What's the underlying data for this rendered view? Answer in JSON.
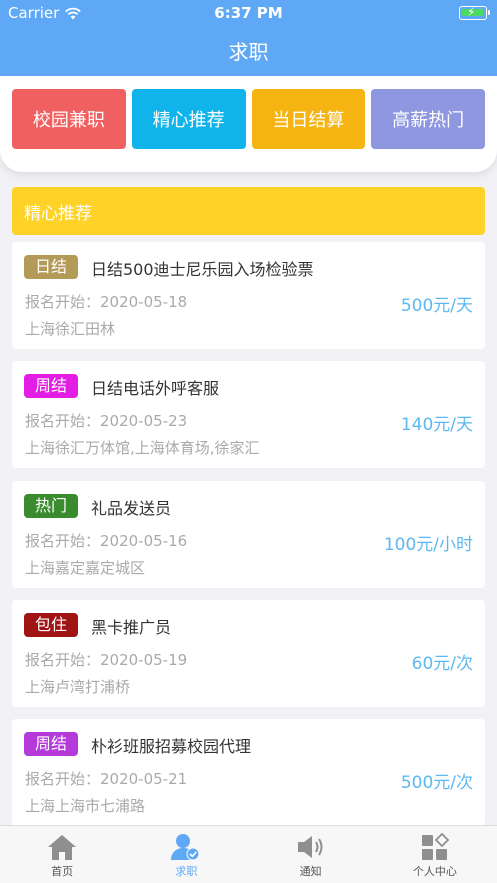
{
  "status_bar": {
    "carrier": "Carrier",
    "time": "6:37 PM"
  },
  "nav": {
    "title": "求职"
  },
  "categories": [
    {
      "label": "校园兼职",
      "color": "#f06060"
    },
    {
      "label": "精心推荐",
      "color": "#10b4eb"
    },
    {
      "label": "当日结算",
      "color": "#f5b412"
    },
    {
      "label": "高薪热门",
      "color": "#8e97e0"
    }
  ],
  "section": {
    "title": "精心推荐",
    "color": "#fed227"
  },
  "jobs": [
    {
      "tag": "日结",
      "tag_color": "#b39a57",
      "title": "日结500迪士尼乐园入场检验票",
      "date": "报名开始：2020-05-18",
      "location": "上海徐汇田林",
      "price": "500元/天"
    },
    {
      "tag": "周结",
      "tag_color": "#e41de4",
      "title": "日结电话外呼客服",
      "date": "报名开始：2020-05-23",
      "location": "上海徐汇万体馆,上海体育场,徐家汇",
      "price": "140元/天"
    },
    {
      "tag": "热门",
      "tag_color": "#3a8b2e",
      "title": "礼品发送员",
      "date": "报名开始：2020-05-16",
      "location": "上海嘉定嘉定城区",
      "price": "100元/小时"
    },
    {
      "tag": "包住",
      "tag_color": "#a01414",
      "title": "黑卡推广员",
      "date": "报名开始：2020-05-19",
      "location": "上海卢湾打浦桥",
      "price": "60元/次"
    },
    {
      "tag": "周结",
      "tag_color": "#b43ad9",
      "title": "朴衫班服招募校园代理",
      "date": "报名开始：2020-05-21",
      "location": "上海上海市七浦路",
      "price": "500元/次"
    }
  ],
  "tabs": [
    {
      "label": "首页",
      "icon": "home-icon"
    },
    {
      "label": "求职",
      "icon": "job-seek-icon",
      "active": true
    },
    {
      "label": "通知",
      "icon": "speaker-icon"
    },
    {
      "label": "个人中心",
      "icon": "grid-profile-icon"
    }
  ],
  "colors": {
    "primary": "#5fa8f5",
    "price": "#5cb8f0"
  }
}
